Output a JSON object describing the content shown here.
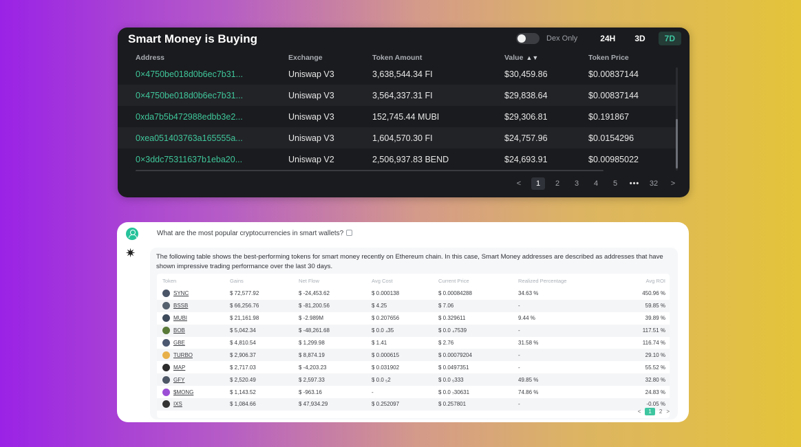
{
  "smart_money": {
    "title": "Smart Money is Buying",
    "dex_only_label": "Dex Only",
    "dex_only_enabled": false,
    "timeframes": [
      "24H",
      "3D",
      "7D"
    ],
    "active_timeframe": "7D",
    "columns": [
      "Address",
      "Exchange",
      "Token Amount",
      "Value",
      "Token Price"
    ],
    "rows": [
      {
        "address": "0×4750be018d0b6ec7b31...",
        "exchange": "Uniswap V3",
        "amount": "3,638,544.34 FI",
        "value": "$30,459.86",
        "price": "$0.00837144"
      },
      {
        "address": "0×4750be018d0b6ec7b31...",
        "exchange": "Uniswap V3",
        "amount": "3,564,337.31 FI",
        "value": "$29,838.64",
        "price": "$0.00837144"
      },
      {
        "address": "0xda7b5b472988edbb3e2...",
        "exchange": "Uniswap V3",
        "amount": "152,745.44 MUBI",
        "value": "$29,306.81",
        "price": "$0.191867"
      },
      {
        "address": "0xea051403763a165555a...",
        "exchange": "Uniswap V3",
        "amount": "1,604,570.30 FI",
        "value": "$24,757.96",
        "price": "$0.0154296"
      },
      {
        "address": "0×3ddc75311637b1eba20...",
        "exchange": "Uniswap V2",
        "amount": "2,506,937.83 BEND",
        "value": "$24,693.91",
        "price": "$0.00985022"
      }
    ],
    "pagination": {
      "prev": "<",
      "pages": [
        "1",
        "2",
        "3",
        "4",
        "5"
      ],
      "ellipsis": "•••",
      "last": "32",
      "next": ">",
      "current": "1"
    }
  },
  "chat": {
    "question": "What are the most popular cryptocurrencies in smart wallets?",
    "answer": "The following table shows the best-performing tokens for smart money recently on Ethereum chain. In this case, Smart Money addresses are described as addresses that have shown impressive trading performance over the last 30 days.",
    "columns": [
      "Token",
      "Gains",
      "Net Flow",
      "Avg Cost",
      "Current Price",
      "Realized Percentage",
      "Avg ROI"
    ],
    "rows": [
      {
        "token": "SYNC",
        "gains": "$ 72,577.92",
        "net": "$ -24,453.62",
        "avg": "$ 0.000138",
        "cur": "$ 0.00084288",
        "real": "34.63 %",
        "roi": "450.96 %",
        "color": "#4a5568"
      },
      {
        "token": "BSSB",
        "gains": "$ 66,256.76",
        "net": "$ -81,200.56",
        "avg": "$ 4.25",
        "cur": "$ 7.06",
        "real": "-",
        "roi": "59.85 %",
        "color": "#55606e"
      },
      {
        "token": "MUBI",
        "gains": "$ 21,161.98",
        "net": "$ -2.989M",
        "avg": "$ 0.207656",
        "cur": "$ 0.329611",
        "real": "9.44 %",
        "roi": "39.89 %",
        "color": "#3d4a5c"
      },
      {
        "token": "BOB",
        "gains": "$ 5,042.34",
        "net": "$ -48,261.68",
        "avg": "$ 0.0 ₄35",
        "cur": "$ 0.0 ₄7539",
        "real": "-",
        "roi": "117.51 %",
        "color": "#5a7a3a"
      },
      {
        "token": "GBE",
        "gains": "$ 4,810.54",
        "net": "$ 1,299.98",
        "avg": "$ 1.41",
        "cur": "$ 2.76",
        "real": "31.58 %",
        "roi": "116.74 %",
        "color": "#4b5870"
      },
      {
        "token": "TURBO",
        "gains": "$ 2,906.37",
        "net": "$ 8,874.19",
        "avg": "$ 0.000615",
        "cur": "$ 0.00079204",
        "real": "-",
        "roi": "29.10 %",
        "color": "#e8b04a"
      },
      {
        "token": "MAP",
        "gains": "$ 2,717.03",
        "net": "$ -4,203.23",
        "avg": "$ 0.031902",
        "cur": "$ 0.0497351",
        "real": "-",
        "roi": "55.52 %",
        "color": "#2c2c2c"
      },
      {
        "token": "GFY",
        "gains": "$ 2,520.49",
        "net": "$ 2,597.33",
        "avg": "$ 0.0 ₅2",
        "cur": "$ 0.0 ₅333",
        "real": "49.85 %",
        "roi": "32.80 %",
        "color": "#4d5766"
      },
      {
        "token": "$MONG",
        "gains": "$ 1,143.52",
        "net": "$ -963.16",
        "avg": "-",
        "cur": "$ 0.0 ₇30631",
        "real": "74.86 %",
        "roi": "24.83 %",
        "color": "#9b4fd6"
      },
      {
        "token": "IXS",
        "gains": "$ 1,084.66",
        "net": "$ 47,934.29",
        "avg": "$ 0.252097",
        "cur": "$ 0.257801",
        "real": "-",
        "roi": "-0.05 %",
        "color": "#333333"
      }
    ],
    "pagination": {
      "prev": "<",
      "pages": [
        "1",
        "2"
      ],
      "current": "1",
      "next": ">"
    }
  }
}
